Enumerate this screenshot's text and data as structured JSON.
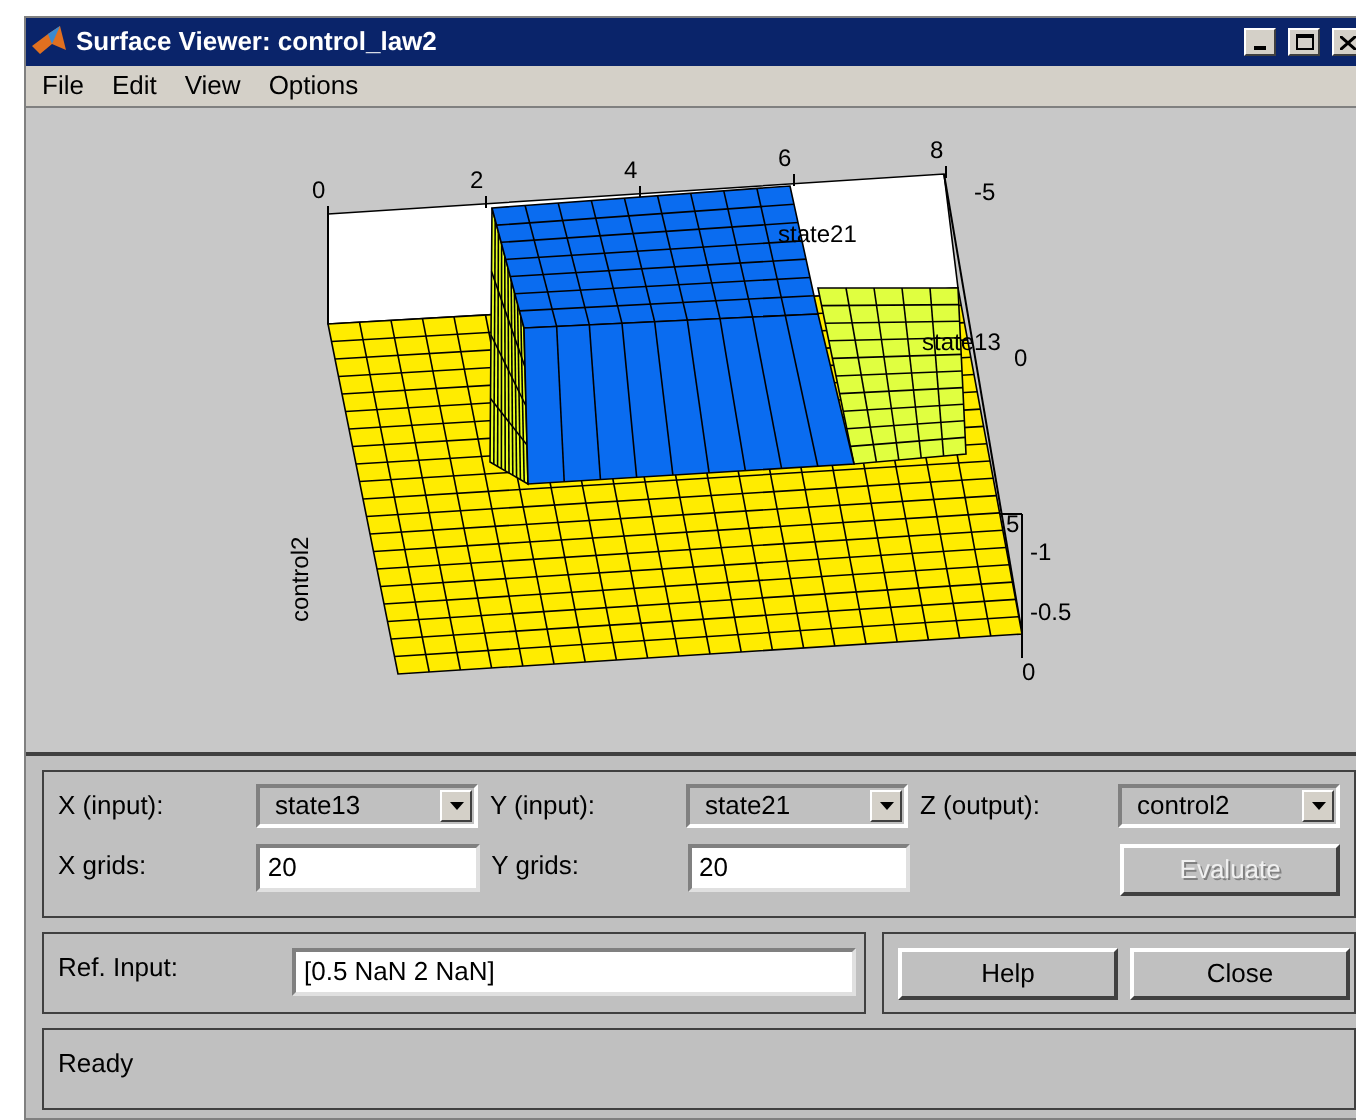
{
  "window": {
    "title": "Surface Viewer: control_law2"
  },
  "menu": [
    "File",
    "Edit",
    "View",
    "Options"
  ],
  "plot": {
    "x_ticks": [
      "0",
      "2",
      "4",
      "6",
      "8"
    ],
    "y_ticks": [
      "-5",
      "0",
      "5"
    ],
    "z_ticks": [
      "-1",
      "-0.5",
      "0"
    ],
    "x_label": "state21",
    "y_label": "state13",
    "z_label": "control2"
  },
  "inputs": {
    "x_label": "X (input):",
    "x_value": "state13",
    "y_label": "Y (input):",
    "y_value": "state21",
    "z_label": "Z (output):",
    "z_value": "control2",
    "x_grids_label": "X grids:",
    "x_grids": "20",
    "y_grids_label": "Y grids:",
    "y_grids": "20"
  },
  "ref_input": {
    "label": "Ref. Input:",
    "value": "[0.5 NaN 2 NaN]"
  },
  "buttons": [
    {
      "label": "Evaluate",
      "disabled": true
    },
    {
      "label": "Help",
      "disabled": false
    },
    {
      "label": "Close",
      "disabled": false
    }
  ],
  "status": "Ready"
}
